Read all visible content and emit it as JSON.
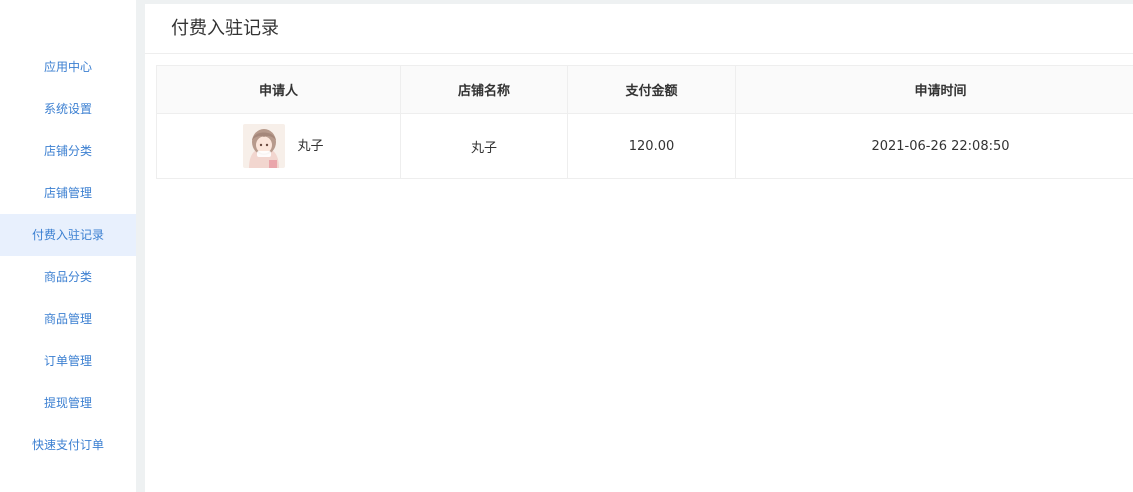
{
  "sidebar": {
    "items": [
      {
        "label": "应用中心"
      },
      {
        "label": "系统设置"
      },
      {
        "label": "店铺分类"
      },
      {
        "label": "店铺管理"
      },
      {
        "label": "付费入驻记录",
        "active": true
      },
      {
        "label": "商品分类"
      },
      {
        "label": "商品管理"
      },
      {
        "label": "订单管理"
      },
      {
        "label": "提现管理"
      },
      {
        "label": "快速支付订单"
      }
    ]
  },
  "page": {
    "title": "付费入驻记录"
  },
  "table": {
    "headers": [
      "申请人",
      "店铺名称",
      "支付金额",
      "申请时间"
    ],
    "rows": [
      {
        "applicant": "丸子",
        "shop_name": "丸子",
        "amount": "120.00",
        "time": "2021-06-26 22:08:50",
        "avatar_icon": "user-avatar"
      }
    ]
  },
  "colors": {
    "accent": "#3b7fd1",
    "active_bg": "#e8f0fd",
    "background": "#eef1f2"
  }
}
